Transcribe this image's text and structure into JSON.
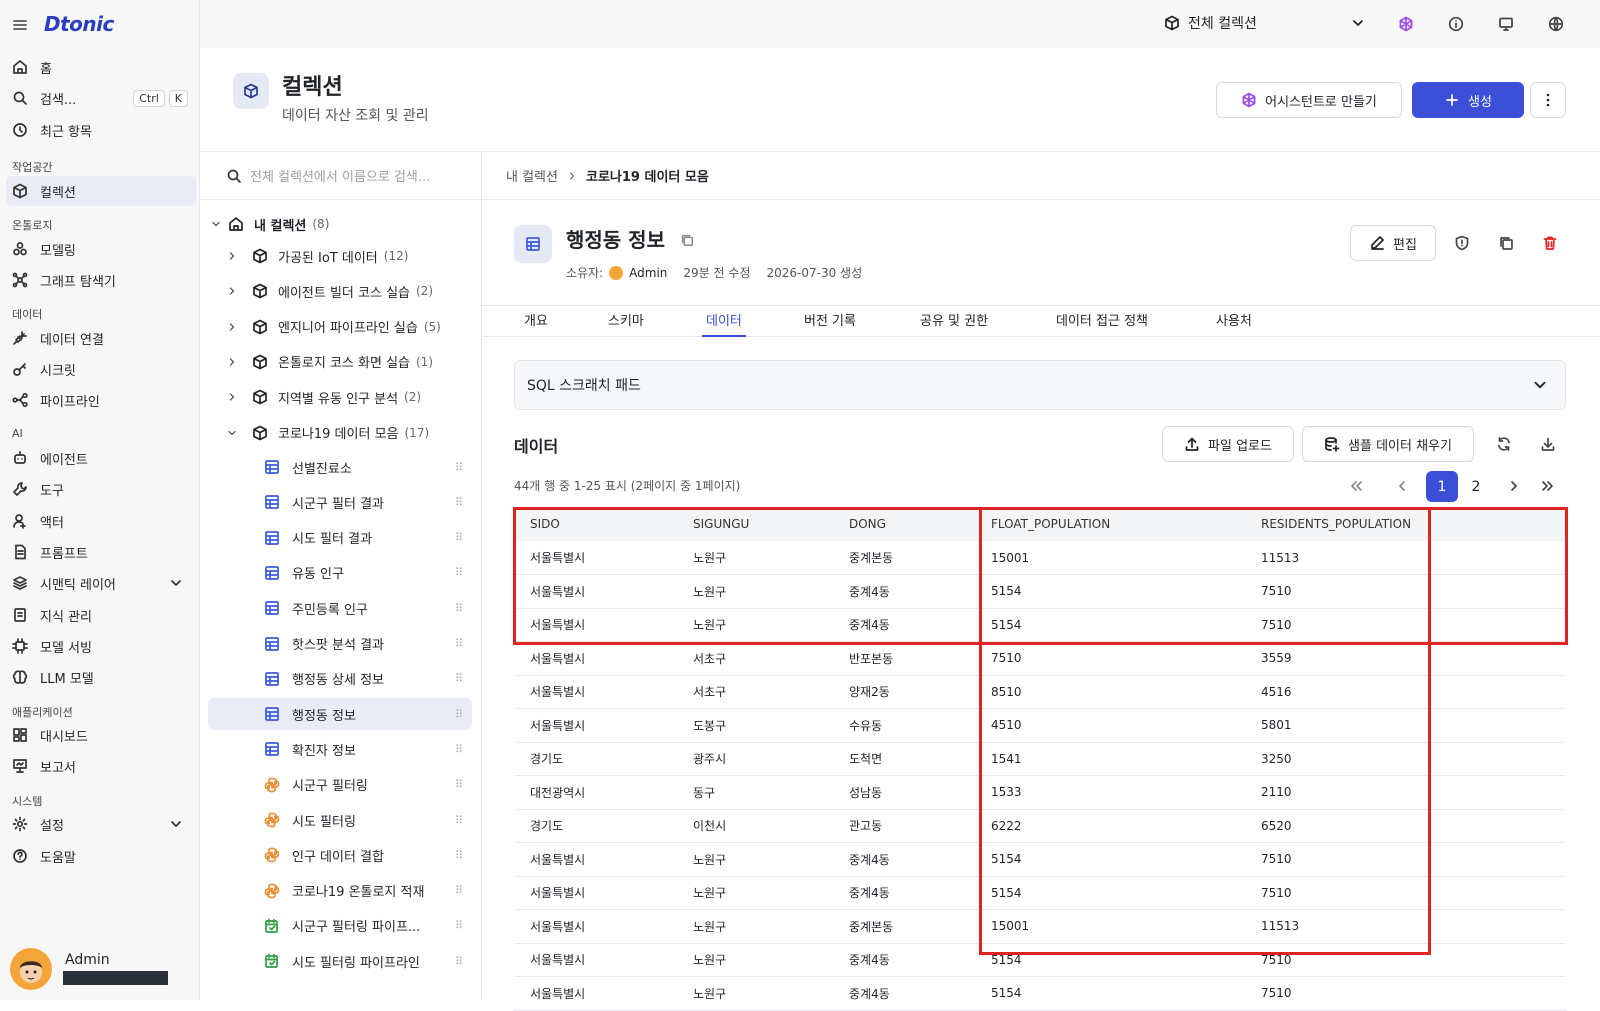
{
  "app": {
    "logo": "Dtonic"
  },
  "sidebar": {
    "top": [
      {
        "label": "홈",
        "icon": "home-icon"
      },
      {
        "label": "검색...",
        "icon": "search-icon",
        "shortcut": [
          "Ctrl",
          "K"
        ]
      },
      {
        "label": "최근 항목",
        "icon": "clock-icon"
      }
    ],
    "sections": {
      "workspace": "작업공간",
      "ontology": "온톨로지",
      "data": "데이터",
      "ai": "AI",
      "apps": "애플리케이션",
      "system": "시스템"
    },
    "items": {
      "collection": "컬렉션",
      "modeling": "모델링",
      "graph": "그래프 탐색기",
      "connect": "데이터 연결",
      "secret": "시크릿",
      "pipeline": "파이프라인",
      "agent": "에이전트",
      "tool": "도구",
      "actor": "액터",
      "prompt": "프롬프트",
      "semantic": "시맨틱 레이어",
      "knowledge": "지식 관리",
      "serving": "모델 서빙",
      "llm": "LLM 모델",
      "dashboard": "대시보드",
      "report": "보고서",
      "settings": "설정",
      "help": "도움말"
    },
    "user": {
      "name": "Admin"
    }
  },
  "topbar": {
    "collection_select": "전체 컬렉션"
  },
  "header": {
    "title": "컬렉션",
    "subtitle": "데이터 자산 조회 및 관리",
    "assistant_button": "어시스턴트로 만들기",
    "create_button": "생성"
  },
  "tree": {
    "search_placeholder": "전체 컬렉션에서 이름으로 검색...",
    "root": {
      "label": "내 컬렉션",
      "count": "(8)"
    },
    "folders": [
      {
        "label": "가공된 IoT 데이터",
        "count": "(12)"
      },
      {
        "label": "에이전트 빌더 코스 실습",
        "count": "(2)"
      },
      {
        "label": "엔지니어 파이프라인 실습",
        "count": "(5)"
      },
      {
        "label": "온톨로지 코스 화면 실습",
        "count": "(1)"
      },
      {
        "label": "지역별 유동 인구 분석",
        "count": "(2)"
      },
      {
        "label": "코로나19 데이터 모음",
        "count": "(17)"
      }
    ],
    "leaves": [
      {
        "label": "선별진료소",
        "icon": "table-icon"
      },
      {
        "label": "시군구 필터 결과",
        "icon": "table-icon"
      },
      {
        "label": "시도 필터 결과",
        "icon": "table-icon"
      },
      {
        "label": "유동 인구",
        "icon": "table-icon"
      },
      {
        "label": "주민등록 인구",
        "icon": "table-icon"
      },
      {
        "label": "핫스팟 분석 결과",
        "icon": "table-icon"
      },
      {
        "label": "행정동 상세 정보",
        "icon": "table-icon"
      },
      {
        "label": "행정동 정보",
        "icon": "table-icon"
      },
      {
        "label": "확진자 정보",
        "icon": "table-icon"
      },
      {
        "label": "시군구 필터링",
        "icon": "python-icon"
      },
      {
        "label": "시도 필터링",
        "icon": "python-icon"
      },
      {
        "label": "인구 데이터 결합",
        "icon": "python-icon"
      },
      {
        "label": "코로나19 온톨로지 적재",
        "icon": "python-icon"
      },
      {
        "label": "시군구 필터링 파이프...",
        "icon": "schedule-icon"
      },
      {
        "label": "시도 필터링 파이프라인",
        "icon": "schedule-icon"
      }
    ]
  },
  "breadcrumb": {
    "parent": "내 컬렉션",
    "current": "코로나19 데이터 모음"
  },
  "dataset": {
    "title": "행정동 정보",
    "owner_label": "소유자:",
    "owner": "Admin",
    "modified": "29분 전 수정",
    "created": "2026-07-30 생성",
    "edit_button": "편집"
  },
  "tabs": [
    "개요",
    "스키마",
    "데이터",
    "버전 기록",
    "공유 및 권한",
    "데이터 접근 정책",
    "사용처"
  ],
  "active_tab": "데이터",
  "sql_pad": {
    "label": "SQL 스크래치 패드"
  },
  "data_section": {
    "title": "데이터",
    "upload_button": "파일 업로드",
    "sample_button": "샘플 데이터 채우기",
    "summary": "44개 행 중 1-25 표시 (2페이지 중 1페이지)",
    "pages": [
      "1",
      "2"
    ],
    "current_page": "1"
  },
  "table": {
    "columns": [
      "SIDO",
      "SIGUNGU",
      "DONG",
      "FLOAT_POPULATION",
      "RESIDENTS_POPULATION"
    ],
    "rows": [
      [
        "서울특별시",
        "노원구",
        "중계본동",
        "15001",
        "11513"
      ],
      [
        "서울특별시",
        "노원구",
        "중계4동",
        "5154",
        "7510"
      ],
      [
        "서울특별시",
        "노원구",
        "중계4동",
        "5154",
        "7510"
      ],
      [
        "서울특별시",
        "서초구",
        "반포본동",
        "7510",
        "3559"
      ],
      [
        "서울특별시",
        "서초구",
        "양재2동",
        "8510",
        "4516"
      ],
      [
        "서울특별시",
        "도봉구",
        "수유동",
        "4510",
        "5801"
      ],
      [
        "경기도",
        "광주시",
        "도척면",
        "1541",
        "3250"
      ],
      [
        "대전광역시",
        "동구",
        "성남동",
        "1533",
        "2110"
      ],
      [
        "경기도",
        "이천시",
        "관고동",
        "6222",
        "6520"
      ],
      [
        "서울특별시",
        "노원구",
        "중계4동",
        "5154",
        "7510"
      ],
      [
        "서울특별시",
        "노원구",
        "중계4동",
        "5154",
        "7510"
      ],
      [
        "서울특별시",
        "노원구",
        "중계본동",
        "15001",
        "11513"
      ],
      [
        "서울특별시",
        "노원구",
        "중계4동",
        "5154",
        "7510"
      ],
      [
        "서울특별시",
        "노원구",
        "중계4동",
        "5154",
        "7510"
      ]
    ]
  },
  "colors": {
    "accent": "#3b4fd8",
    "highlight": "#e02424",
    "assistant": "#9b4dea"
  }
}
